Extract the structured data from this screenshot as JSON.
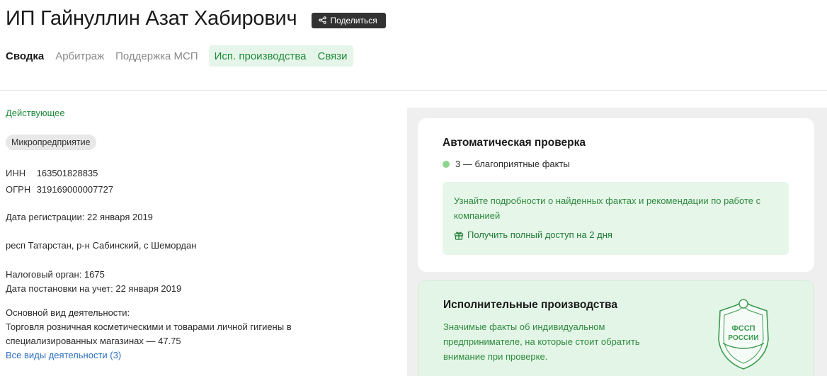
{
  "header": {
    "title": "ИП Гайнуллин Азат Хабирович",
    "share_label": "Поделиться"
  },
  "tabs": [
    {
      "label": "Сводка",
      "active": true
    },
    {
      "label": "Арбитраж",
      "active": false
    },
    {
      "label": "Поддержка МСП",
      "active": false
    },
    {
      "label": "Исп. производства",
      "active": false
    },
    {
      "label": "Связи",
      "active": false
    }
  ],
  "summary": {
    "status": "Действующее",
    "badge": "Микропредприятие",
    "inn_label": "ИНН",
    "inn_value": "163501828835",
    "ogrn_label": "ОГРН",
    "ogrn_value": "319169000007727",
    "registration": "Дата регистрации: 22 января 2019",
    "address": "респ Татарстан, р-н Сабинский, с Шемордан",
    "tax_office": "Налоговый орган: 1675",
    "tax_date": "Дата постановки на учет: 22 января 2019",
    "activity_label": "Основной вид деятельности:",
    "activity_line1": "Торговля розничная косметическими и товарами личной гигиены в",
    "activity_line2": "специализированных магазинах — 47.75",
    "activities_link": "Все виды деятельности (3)"
  },
  "auto_check": {
    "title": "Автоматическая проверка",
    "facts": "3 — благоприятные факты",
    "facts_color": "#8fd48f",
    "promo_text": "Узнайте подробности о найденных фактах и рекомендации по работе с компанией",
    "promo_link": "Получить полный доступ на 2 дня"
  },
  "exec_proceedings": {
    "title": "Исполнительные производства",
    "text": "Значимые факты об индивидуальном предпринимателе, на которые стоит обратить внимание при проверке.",
    "emblem_line1": "ФССП",
    "emblem_line2": "РОССИИ"
  },
  "colors": {
    "accent_green": "#1f8a3a",
    "link_blue": "#2a6ebf",
    "share_bg": "#333333"
  }
}
